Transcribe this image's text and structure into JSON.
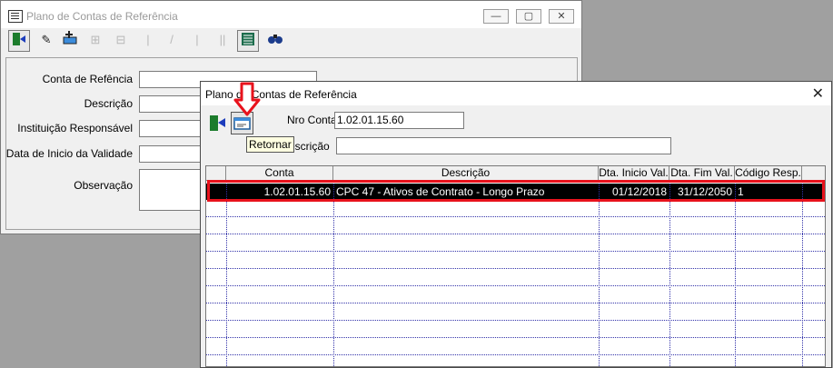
{
  "back_window": {
    "title": "Plano de Contas de Referência",
    "controls": {
      "minimize": "—",
      "maximize": "▢",
      "close": "✕"
    },
    "fields": [
      {
        "label": "Conta de Refência"
      },
      {
        "label": "Descrição"
      },
      {
        "label": "Instituição Responsável"
      },
      {
        "label": "Data de Inicio da Validade"
      },
      {
        "label": "Observação"
      }
    ]
  },
  "front_window": {
    "title": "Plano de Contas de Referência",
    "close": "✕",
    "nro_conta_label": "Nro Conta",
    "nro_conta_value": "1.02.01.15.60",
    "descricao_label": "Descrição",
    "descricao_label_visible": "escrição",
    "descricao_value": "",
    "tooltip": "Retornar",
    "grid": {
      "columns": [
        "Conta",
        "Descrição",
        "Dta. Inicio Val.",
        "Dta. Fim Val.",
        "Código Resp."
      ],
      "rows": [
        [
          "1.02.01.15.60",
          "CPC 47 - Ativos de Contrato - Longo Prazo",
          "01/12/2018",
          "31/12/2050",
          "1"
        ]
      ]
    }
  },
  "colors": {
    "highlight": "#e8121c",
    "selected_row": "#000000",
    "grid_lines": "#3333aa"
  }
}
